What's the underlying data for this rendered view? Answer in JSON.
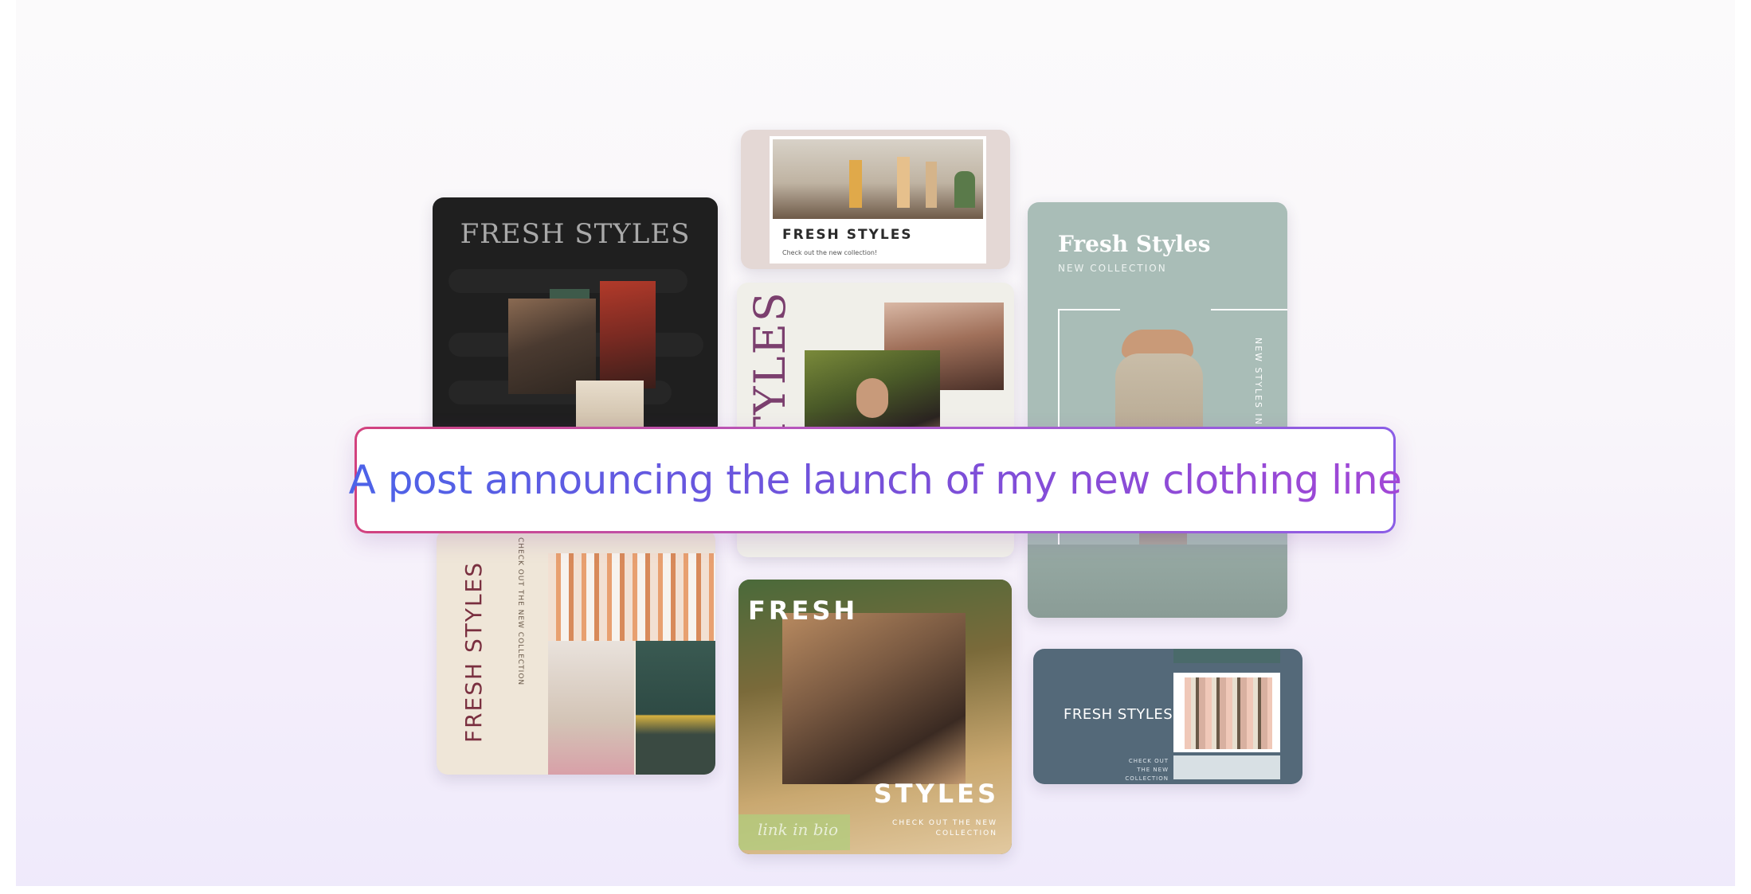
{
  "prompt": {
    "text": "A post announcing the launch of my new clothing line"
  },
  "templates": {
    "dark": {
      "title": "FRESH STYLES"
    },
    "boutique": {
      "title": "FRESH STYLES",
      "subtitle": "Check out the new collection!"
    },
    "vertical": {
      "title": "STYLES"
    },
    "sage": {
      "title": "Fresh Styles",
      "subtitle": "NEW COLLECTION",
      "side_text": "NEW STYLES IN STORE"
    },
    "beige": {
      "title": "FRESH STYLES",
      "side_text": "CHECK OUT THE NEW COLLECTION"
    },
    "gold": {
      "title_top": "FRESH",
      "title_bottom": "STYLES",
      "script": "link in bio",
      "subtitle": "CHECK OUT THE NEW COLLECTION"
    },
    "slate": {
      "title": "FRESH STYLES",
      "subtitle": "CHECK OUT THE NEW COLLECTION"
    }
  },
  "colors": {
    "prompt_border_start": "#d2417e",
    "prompt_border_end": "#8a5de6",
    "prompt_text_start": "#4c63e8",
    "prompt_text_end": "#a247d6"
  }
}
